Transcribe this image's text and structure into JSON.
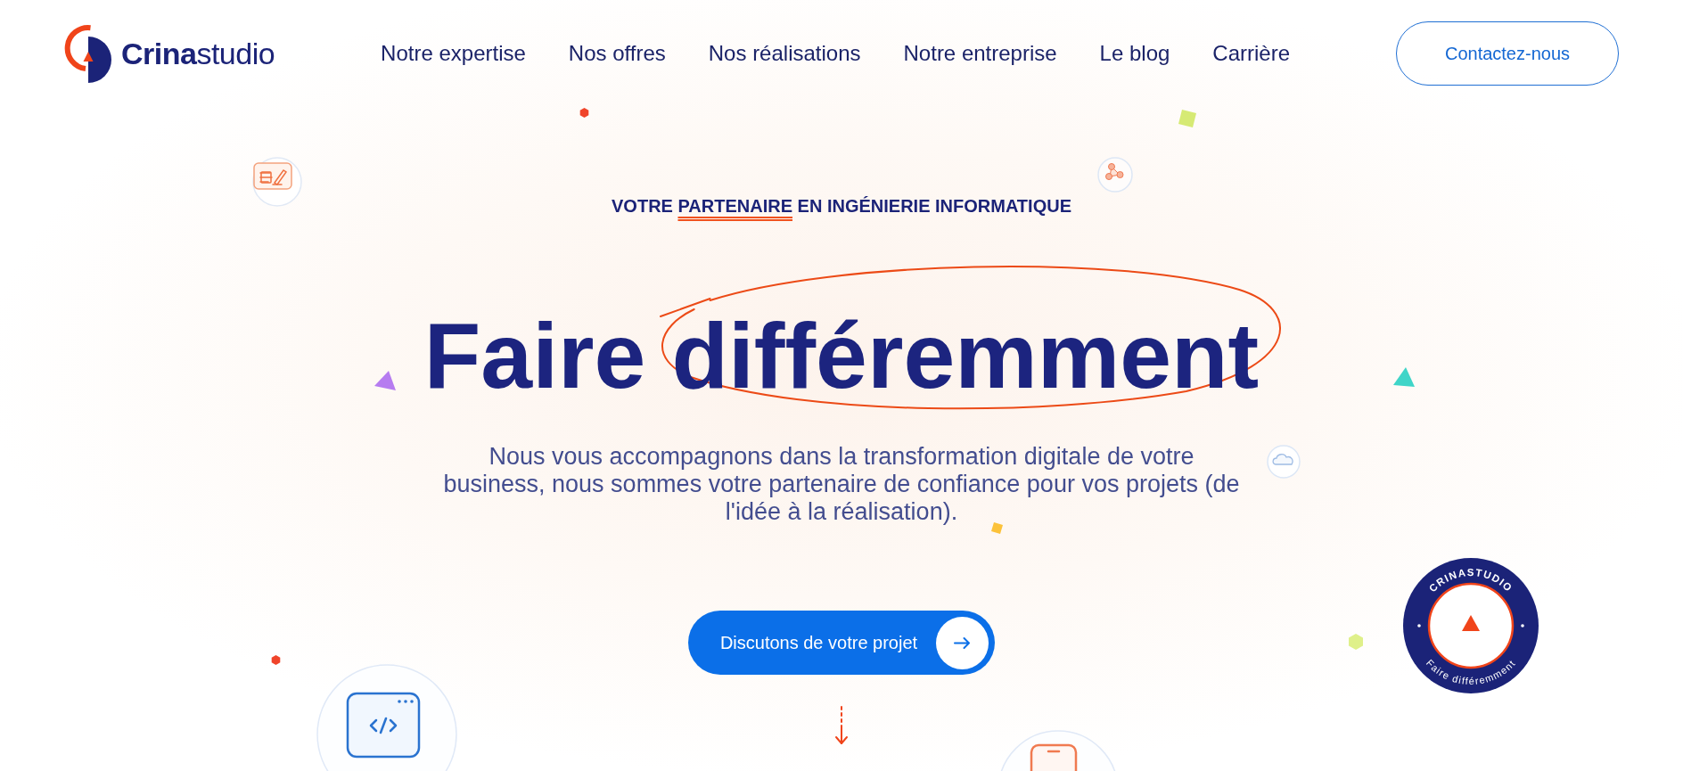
{
  "header": {
    "logo": "**Crina**studio",
    "nav": [
      "Notre expertise",
      "Nos offres",
      "Nos réalisations",
      "Notre entreprise",
      "Le blog",
      "Carrière"
    ],
    "contact_button": "Contactez-nous"
  },
  "hero": {
    "eyebrow": {
      "lead": "VOTRE",
      "highlight": "PARTENAIRE",
      "rest": "EN INGÉNIERIE INFORMATIQUE"
    },
    "headline": {
      "lead": "Faire",
      "circled": "différemment"
    },
    "description": "Nous vous accompagnons dans la transformation digitale de votre business, nous sommes votre partenaire de confiance pour vos projets (de l'idée à la réalisation).",
    "cta_button": "Discutons de votre projet"
  },
  "badge": {
    "top_text": "CRINASTUDIO",
    "bottom_text": "Faire différemment"
  }
}
